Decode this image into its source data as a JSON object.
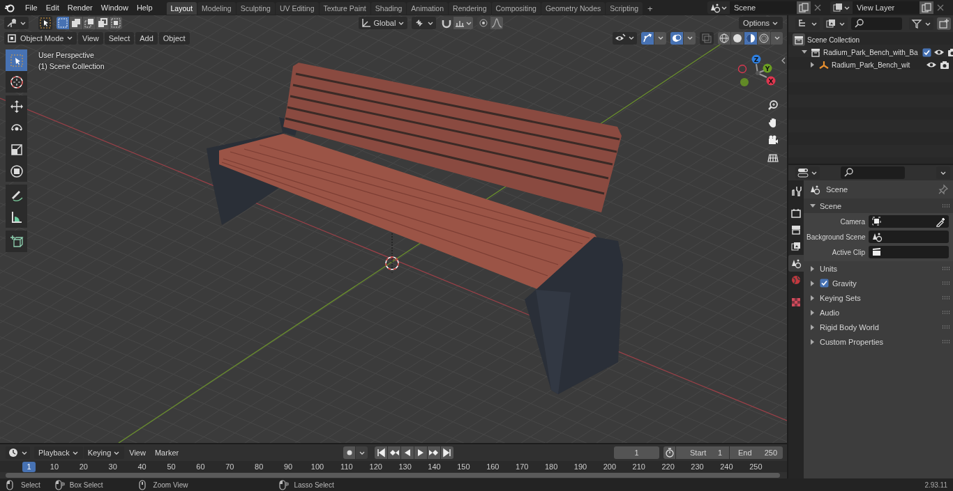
{
  "menu_bar": {
    "menus": [
      "File",
      "Edit",
      "Render",
      "Window",
      "Help"
    ]
  },
  "workspace_tabs": [
    {
      "label": "Layout",
      "selected": true
    },
    {
      "label": "Modeling",
      "selected": false
    },
    {
      "label": "Sculpting",
      "selected": false
    },
    {
      "label": "UV Editing",
      "selected": false
    },
    {
      "label": "Texture Paint",
      "selected": false
    },
    {
      "label": "Shading",
      "selected": false
    },
    {
      "label": "Animation",
      "selected": false
    },
    {
      "label": "Rendering",
      "selected": false
    },
    {
      "label": "Compositing",
      "selected": false
    },
    {
      "label": "Geometry Nodes",
      "selected": false
    },
    {
      "label": "Scripting",
      "selected": false
    }
  ],
  "add_workspace": "+",
  "scene_selector": {
    "value": "Scene"
  },
  "view_layer_selector": {
    "value": "View Layer"
  },
  "viewport": {
    "tool_header": {
      "select_modes": [
        {
          "kind": "set",
          "selected": true
        },
        {
          "kind": "extend",
          "selected": false
        },
        {
          "kind": "subtract",
          "selected": false
        },
        {
          "kind": "difference",
          "selected": false
        },
        {
          "kind": "intersect",
          "selected": false
        }
      ],
      "transform_orientation": "Global",
      "options": "Options"
    },
    "header": {
      "mode": "Object Mode",
      "menus": [
        "View",
        "Select",
        "Add",
        "Object"
      ],
      "shading_modes": [
        {
          "kind": "wireframe",
          "selected": false
        },
        {
          "kind": "solid",
          "selected": false
        },
        {
          "kind": "material",
          "selected": true
        },
        {
          "kind": "rendered",
          "selected": false
        }
      ]
    },
    "info": [
      "User Perspective",
      "(1) Scene Collection"
    ],
    "tools": [
      {
        "kind": "select",
        "selected": true
      },
      {
        "kind": "cursor",
        "selected": false
      },
      {
        "kind": "move",
        "selected": false
      },
      {
        "kind": "rotate",
        "selected": false
      },
      {
        "kind": "scale",
        "selected": false
      },
      {
        "kind": "transform",
        "selected": false
      },
      {
        "kind": "annotate",
        "selected": false
      },
      {
        "kind": "measure",
        "selected": false
      },
      {
        "kind": "add_cube",
        "selected": false
      }
    ],
    "navigation_gizmo": {
      "axes": [
        {
          "label": "Z",
          "color": "#2e7fe0"
        },
        {
          "label": "Y",
          "color": "#6b9e22"
        },
        {
          "label": "X",
          "color": "#e0364f"
        }
      ]
    }
  },
  "outliner": {
    "items": [
      {
        "label": "Scene Collection",
        "kind": "scene",
        "children": [
          {
            "label": "Radium_Park_Bench_with_Ba",
            "kind": "collection",
            "expanded": true,
            "checked": true,
            "children": [
              {
                "label": "Radium_Park_Bench_wit",
                "kind": "empty",
                "expanded": false
              }
            ]
          }
        ]
      }
    ]
  },
  "properties": {
    "tabs": [
      {
        "kind": "tool",
        "selected": false
      },
      {
        "kind": "render",
        "selected": false
      },
      {
        "kind": "output",
        "selected": false
      },
      {
        "kind": "view_layer",
        "selected": false
      },
      {
        "kind": "scene",
        "selected": true
      },
      {
        "kind": "world",
        "selected": false
      },
      {
        "kind": "texture",
        "selected": false
      }
    ],
    "context": "Scene",
    "panels": [
      {
        "title": "Scene",
        "kind": "plain",
        "expanded": true,
        "fields": [
          {
            "label": "Camera",
            "kind": "camera"
          },
          {
            "label": "Background Scene",
            "kind": "scene"
          },
          {
            "label": "Active Clip",
            "kind": "clip"
          }
        ]
      },
      {
        "title": "Units",
        "kind": "plain",
        "expanded": false
      },
      {
        "title": "Gravity",
        "kind": "checkbox",
        "checked": true,
        "expanded": false
      },
      {
        "title": "Keying Sets",
        "kind": "plain",
        "expanded": false
      },
      {
        "title": "Audio",
        "kind": "plain",
        "expanded": false
      },
      {
        "title": "Rigid Body World",
        "kind": "plain",
        "expanded": false
      },
      {
        "title": "Custom Properties",
        "kind": "plain",
        "expanded": false
      }
    ]
  },
  "timeline": {
    "menus": [
      "Playback",
      "Keying",
      "View",
      "Marker"
    ],
    "current_frame": "1",
    "start_label": "Start",
    "start": "1",
    "end_label": "End",
    "end": "250",
    "frame_marker": "1",
    "ruler": [
      "10",
      "20",
      "30",
      "40",
      "50",
      "60",
      "70",
      "80",
      "90",
      "100",
      "110",
      "120",
      "130",
      "140",
      "150",
      "160",
      "170",
      "180",
      "190",
      "200",
      "210",
      "220",
      "230",
      "240",
      "250"
    ]
  },
  "status_bar": {
    "hints": [
      {
        "label": "Select",
        "kind": "left"
      },
      {
        "label": "Box Select",
        "kind": "drag"
      },
      {
        "label": "Zoom View",
        "kind": "middle"
      },
      {
        "label": "Lasso Select",
        "kind": "drag"
      }
    ],
    "version": "2.93.11"
  }
}
